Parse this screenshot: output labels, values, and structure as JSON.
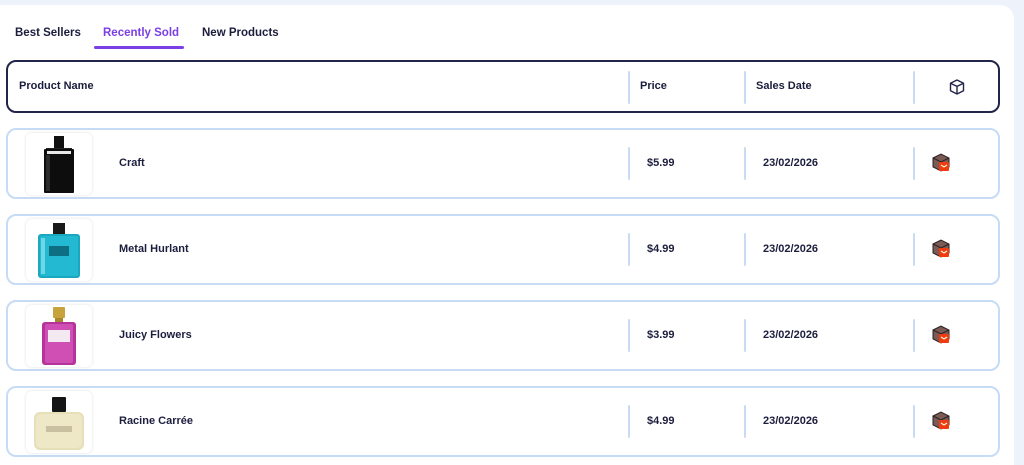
{
  "tabs": [
    {
      "label": "Best Sellers",
      "active": false
    },
    {
      "label": "Recently Sold",
      "active": true
    },
    {
      "label": "New Products",
      "active": false
    }
  ],
  "accent_color": "#7b3fe4",
  "table": {
    "headers": {
      "product_name": "Product Name",
      "price": "Price",
      "sales_date": "Sales Date",
      "action_icon": "box-icon"
    },
    "rows": [
      {
        "name": "Craft",
        "price": "$5.99",
        "sales_date": "23/02/2026",
        "action_icon": "order-box-icon"
      },
      {
        "name": "Metal Hurlant",
        "price": "$4.99",
        "sales_date": "23/02/2026",
        "action_icon": "order-box-icon"
      },
      {
        "name": "Juicy Flowers",
        "price": "$3.99",
        "sales_date": "23/02/2026",
        "action_icon": "order-box-icon"
      },
      {
        "name": "Racine Carrée",
        "price": "$4.99",
        "sales_date": "23/02/2026",
        "action_icon": "order-box-icon"
      }
    ]
  }
}
